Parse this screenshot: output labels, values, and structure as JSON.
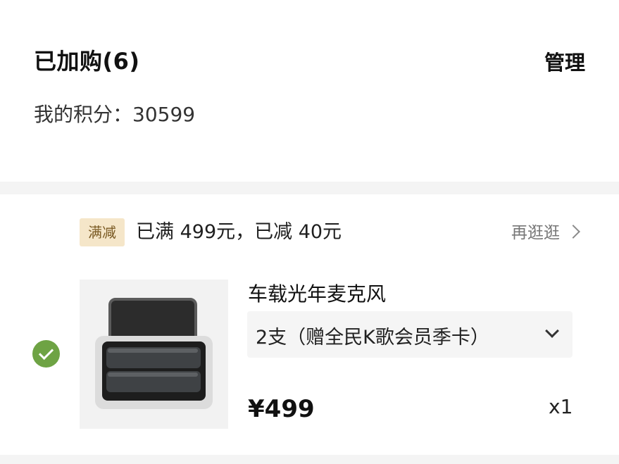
{
  "header": {
    "title": "已加购(6)",
    "manage_label": "管理",
    "points_label": "我的积分：",
    "points_value": "30599"
  },
  "promo": {
    "badge": "满减",
    "text": "已满 499元，已减 40元",
    "shop_more": "再逛逛",
    "badge_bg": "#f5e6c9",
    "badge_fg": "#7a5a23"
  },
  "item": {
    "selected": true,
    "check_icon": "check-circle-icon",
    "name": "车载光年麦克风",
    "variant": "2支（赠全民K歌会员季卡）",
    "price": "¥499",
    "qty": "x1",
    "accent_green": "#6ea344"
  }
}
